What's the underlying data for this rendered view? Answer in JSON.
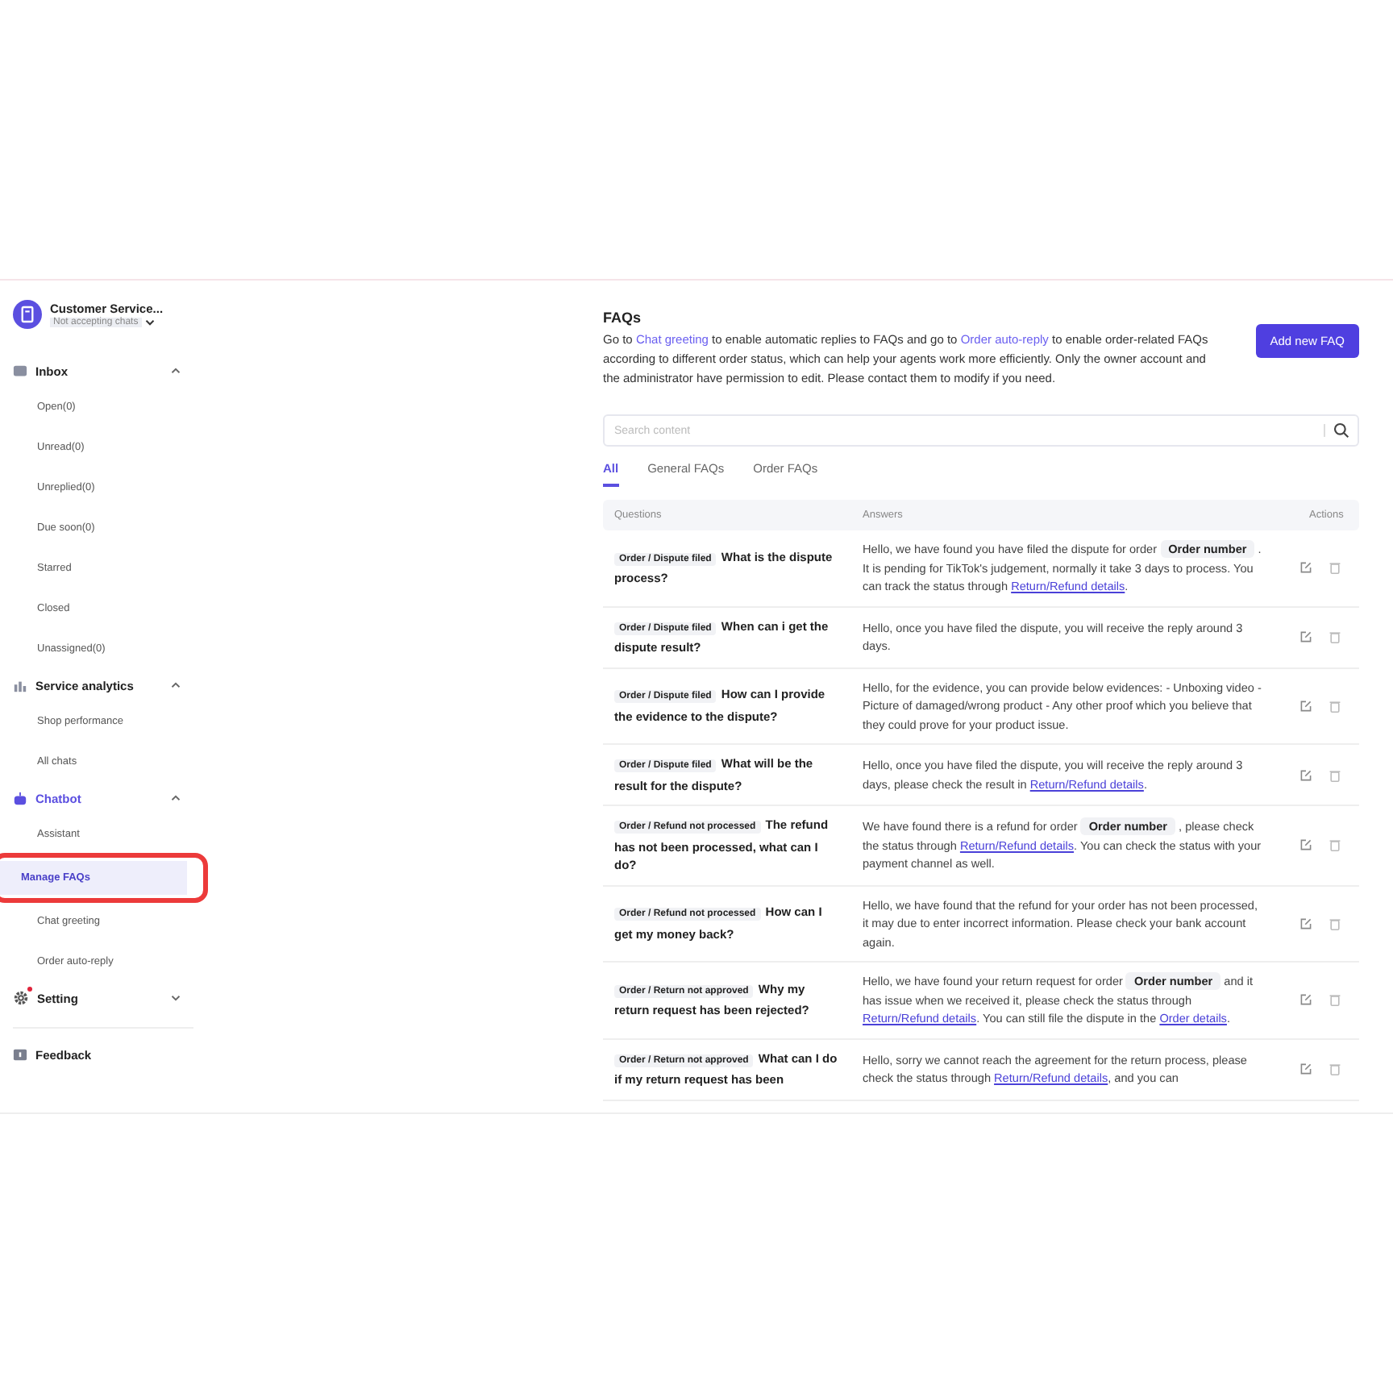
{
  "account": {
    "name": "Customer Service...",
    "status": "Not accepting chats"
  },
  "sidebar": {
    "sections": [
      {
        "label": "Inbox",
        "expanded": true,
        "active": false,
        "badge": false,
        "items": [
          {
            "label": "Open(0)",
            "selected": false
          },
          {
            "label": "Unread(0)",
            "selected": false
          },
          {
            "label": "Unreplied(0)",
            "selected": false
          },
          {
            "label": "Due soon(0)",
            "selected": false
          },
          {
            "label": "Starred",
            "selected": false
          },
          {
            "label": "Closed",
            "selected": false
          },
          {
            "label": "Unassigned(0)",
            "selected": false
          }
        ]
      },
      {
        "label": "Service analytics",
        "expanded": true,
        "active": false,
        "badge": false,
        "items": [
          {
            "label": "Shop performance",
            "selected": false
          },
          {
            "label": "All chats",
            "selected": false
          }
        ]
      },
      {
        "label": "Chatbot",
        "expanded": true,
        "active": true,
        "badge": false,
        "items": [
          {
            "label": "Assistant",
            "selected": false
          },
          {
            "label": "Manage FAQs",
            "selected": true,
            "highlighted": true
          },
          {
            "label": "Chat greeting",
            "selected": false
          },
          {
            "label": "Order auto-reply",
            "selected": false
          }
        ]
      },
      {
        "label": "Setting",
        "expanded": false,
        "active": false,
        "badge": true
      }
    ],
    "footer": {
      "label": "Feedback"
    }
  },
  "page": {
    "title": "FAQs",
    "intro": [
      {
        "kind": "text",
        "text": "Go to "
      },
      {
        "kind": "link",
        "text": "Chat greeting"
      },
      {
        "kind": "text",
        "text": " to enable automatic replies to FAQs and go to "
      },
      {
        "kind": "link",
        "text": "Order auto-reply"
      },
      {
        "kind": "text",
        "text": " to enable order-related FAQs according to different order status, which can help your agents work more efficiently. Only the owner account and the administrator have permission to edit. Please contact them to modify if you need."
      }
    ],
    "add_button": "Add new FAQ",
    "search": {
      "placeholder": "Search content"
    },
    "tabs": [
      {
        "label": "All",
        "selected": true
      },
      {
        "label": "General FAQs",
        "selected": false
      },
      {
        "label": "Order FAQs",
        "selected": false
      }
    ]
  },
  "table": {
    "columns": [
      "Questions",
      "Answers",
      "Actions"
    ],
    "rows": [
      {
        "tag": "Order / Dispute filed",
        "question": "What is the dispute process?",
        "answer": [
          {
            "kind": "text",
            "text": "Hello, we have found you have filed the dispute for order "
          },
          {
            "kind": "chip",
            "text": "Order number"
          },
          {
            "kind": "text",
            "text": " . It is pending for TikTok's judgement, normally it take 3 days to process. You can track the status through "
          },
          {
            "kind": "link",
            "text": "Return/Refund details"
          },
          {
            "kind": "text",
            "text": "."
          }
        ]
      },
      {
        "tag": "Order / Dispute filed",
        "question": "When can i get the dispute result?",
        "answer": [
          {
            "kind": "text",
            "text": "Hello, once you have filed the dispute, you will receive the reply around 3 days."
          }
        ]
      },
      {
        "tag": "Order / Dispute filed",
        "question": "How can I provide the evidence to the dispute?",
        "answer": [
          {
            "kind": "text",
            "text": "Hello, for the evidence, you can provide below evidences: - Unboxing video - Picture of damaged/wrong product - Any other proof which you believe that they could prove for your product issue."
          }
        ]
      },
      {
        "tag": "Order / Dispute filed",
        "question": "What will be the result for the dispute?",
        "answer": [
          {
            "kind": "text",
            "text": "Hello, once you have filed the dispute, you will receive the reply around 3 days, please check the result in "
          },
          {
            "kind": "link",
            "text": "Return/Refund details"
          },
          {
            "kind": "text",
            "text": "."
          }
        ]
      },
      {
        "tag": "Order / Refund not processed",
        "question": "The refund has not been processed, what can I do?",
        "answer": [
          {
            "kind": "text",
            "text": "We have found there is a refund for order "
          },
          {
            "kind": "chip",
            "text": "Order number"
          },
          {
            "kind": "text",
            "text": " , please check the status through "
          },
          {
            "kind": "link",
            "text": "Return/Refund details"
          },
          {
            "kind": "text",
            "text": ". You can check the status with your payment channel as well."
          }
        ]
      },
      {
        "tag": "Order / Refund not processed",
        "question": "How can I get my money back?",
        "answer": [
          {
            "kind": "text",
            "text": "Hello, we have found that the refund for your order has not been processed, it may due to enter incorrect information. Please check your bank account again."
          }
        ]
      },
      {
        "tag": "Order / Return not approved",
        "question": "Why my return request has been rejected?",
        "answer": [
          {
            "kind": "text",
            "text": "Hello, we have found your return request for order "
          },
          {
            "kind": "chip",
            "text": "Order number"
          },
          {
            "kind": "text",
            "text": " and it has issue when we received it, please check the status through "
          },
          {
            "kind": "link",
            "text": "Return/Refund details"
          },
          {
            "kind": "text",
            "text": ". You can still file the dispute in the "
          },
          {
            "kind": "link",
            "text": "Order details"
          },
          {
            "kind": "text",
            "text": "."
          }
        ]
      },
      {
        "tag": "Order / Return not approved",
        "question": "What can I do if my return request has been",
        "answer": [
          {
            "kind": "text",
            "text": "Hello, sorry we cannot reach the agreement for the return process, please check the status through "
          },
          {
            "kind": "link",
            "text": "Return/Refund details"
          },
          {
            "kind": "text",
            "text": ", and you can"
          }
        ]
      }
    ]
  }
}
